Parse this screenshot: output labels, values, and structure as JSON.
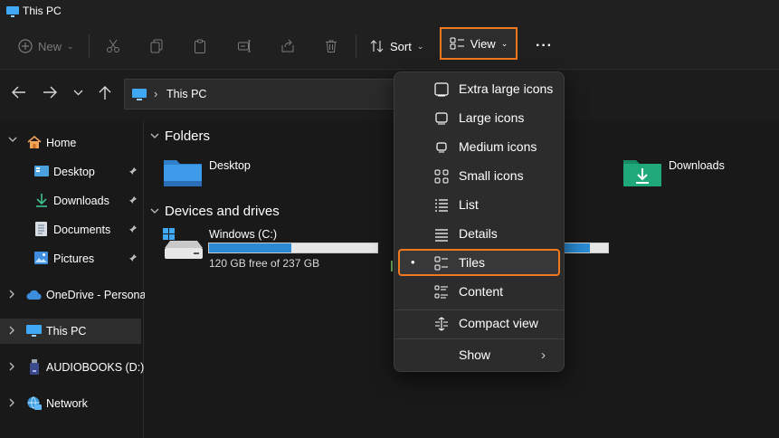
{
  "window": {
    "title": "This PC"
  },
  "toolbar": {
    "new_label": "New",
    "sort_label": "Sort",
    "view_label": "View",
    "more_label": "···"
  },
  "address": {
    "separator": "›",
    "location": "This PC"
  },
  "sidebar": {
    "items": [
      {
        "label": "Home"
      },
      {
        "label": "Desktop"
      },
      {
        "label": "Downloads"
      },
      {
        "label": "Documents"
      },
      {
        "label": "Pictures"
      },
      {
        "label": "OneDrive - Personal"
      },
      {
        "label": "This PC"
      },
      {
        "label": "AUDIOBOOKS (D:)"
      },
      {
        "label": "Network"
      }
    ]
  },
  "main": {
    "folders_header": "Folders",
    "folders": [
      {
        "label": "Desktop"
      },
      {
        "label": "Downloads"
      }
    ],
    "drives_header": "Devices and drives",
    "drives": [
      {
        "label": "Windows (C:)",
        "free_text": "120 GB free of 237 GB",
        "used_fraction": 0.49
      },
      {
        "used_fraction": 0.6
      }
    ]
  },
  "view_menu": {
    "items": [
      {
        "label": "Extra large icons"
      },
      {
        "label": "Large icons"
      },
      {
        "label": "Medium icons"
      },
      {
        "label": "Small icons"
      },
      {
        "label": "List"
      },
      {
        "label": "Details"
      },
      {
        "label": "Tiles",
        "selected_marker": "•"
      },
      {
        "label": "Content"
      },
      {
        "label": "Compact view"
      },
      {
        "label": "Show",
        "submenu_glyph": "›"
      }
    ]
  },
  "colors": {
    "accent": "#f0781e",
    "progress": "#2a8ad4",
    "folder_blue": "#3d9be9",
    "folder_green": "#1fa87a"
  }
}
